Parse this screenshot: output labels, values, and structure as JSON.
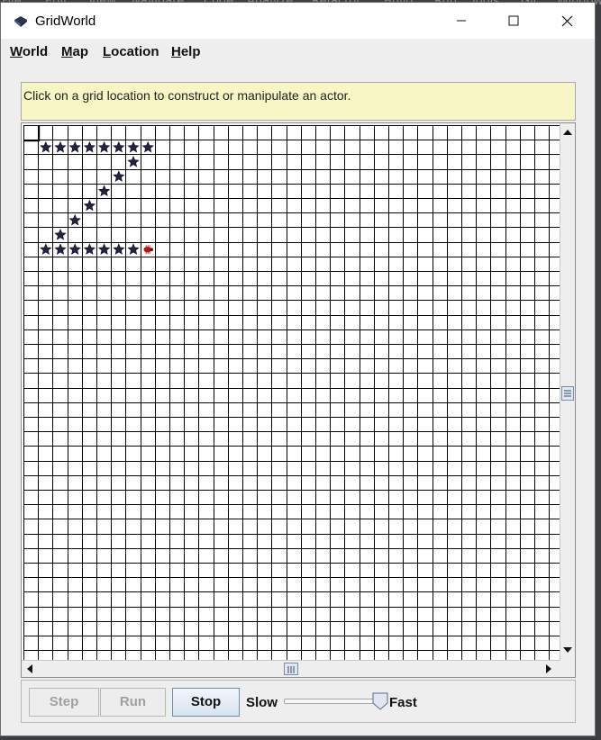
{
  "app": {
    "title": "GridWorld",
    "icon": "gridworld-bug-icon"
  },
  "window_controls": [
    "minimize-icon",
    "maximize-icon",
    "close-icon"
  ],
  "background_menu": [
    "File",
    "Edit",
    "View",
    "Navigate",
    "Code",
    "Analyze",
    "Refactor",
    "Build",
    "Run",
    "Tools",
    "Git",
    "Window"
  ],
  "menu": [
    {
      "mnemonic": "W",
      "rest": "orld"
    },
    {
      "mnemonic": "M",
      "rest": "ap"
    },
    {
      "mnemonic": "L",
      "rest": "ocation"
    },
    {
      "mnemonic": "H",
      "rest": "elp"
    }
  ],
  "message": "Click on a grid location to construct or manipulate an actor.",
  "grid": {
    "visible_columns": 37,
    "visible_rows": 37,
    "selected_cell": {
      "row": 0,
      "col": 0
    },
    "actors": [
      {
        "type": "flower",
        "row": 1,
        "col": 1
      },
      {
        "type": "flower",
        "row": 1,
        "col": 2
      },
      {
        "type": "flower",
        "row": 1,
        "col": 3
      },
      {
        "type": "flower",
        "row": 1,
        "col": 4
      },
      {
        "type": "flower",
        "row": 1,
        "col": 5
      },
      {
        "type": "flower",
        "row": 1,
        "col": 6
      },
      {
        "type": "flower",
        "row": 1,
        "col": 7
      },
      {
        "type": "flower",
        "row": 1,
        "col": 8
      },
      {
        "type": "flower",
        "row": 2,
        "col": 7
      },
      {
        "type": "flower",
        "row": 3,
        "col": 6
      },
      {
        "type": "flower",
        "row": 4,
        "col": 5
      },
      {
        "type": "flower",
        "row": 5,
        "col": 4
      },
      {
        "type": "flower",
        "row": 6,
        "col": 3
      },
      {
        "type": "flower",
        "row": 7,
        "col": 2
      },
      {
        "type": "flower",
        "row": 8,
        "col": 1
      },
      {
        "type": "flower",
        "row": 8,
        "col": 2
      },
      {
        "type": "flower",
        "row": 8,
        "col": 3
      },
      {
        "type": "flower",
        "row": 8,
        "col": 4
      },
      {
        "type": "flower",
        "row": 8,
        "col": 5
      },
      {
        "type": "flower",
        "row": 8,
        "col": 6
      },
      {
        "type": "flower",
        "row": 8,
        "col": 7
      },
      {
        "type": "bug",
        "row": 8,
        "col": 8
      }
    ],
    "flower_color": "#1f2440",
    "bug_color": "#b01616",
    "line_color": "#000000"
  },
  "scroll": {
    "vertical_position": 0.5,
    "horizontal_position": 0.5
  },
  "controls": {
    "step": "Step",
    "run": "Run",
    "stop": "Stop",
    "slow": "Slow",
    "fast": "Fast",
    "speed": 0.95
  }
}
